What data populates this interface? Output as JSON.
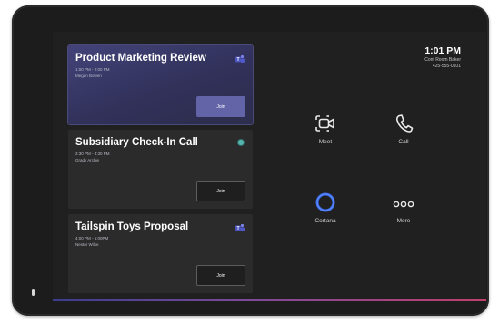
{
  "meetings": [
    {
      "title": "Product Marketing Review",
      "time": "1:00 PM - 2:00 PM",
      "organizer": "Megan Bowen",
      "join_label": "Join",
      "icon": "teams-icon",
      "active": true
    },
    {
      "title": "Subsidiary Check-In Call",
      "time": "2:30 PM - 3:30 PM",
      "organizer": "Grady Archie",
      "join_label": "Join",
      "icon": "status-dot-icon",
      "active": false
    },
    {
      "title": "Tailspin Toys Proposal",
      "time": "4:00 PM - 5:00PM",
      "organizer": "Nestor Wilke",
      "join_label": "Join",
      "icon": "teams-icon",
      "active": false
    }
  ],
  "header": {
    "time": "1:01 PM",
    "room": "Conf Room Baker",
    "phone": "425-555-0101"
  },
  "actions": [
    {
      "label": "Meet",
      "icon": "video-camera-icon"
    },
    {
      "label": "Call",
      "icon": "phone-icon"
    },
    {
      "label": "Cortana",
      "icon": "cortana-icon"
    },
    {
      "label": "More",
      "icon": "more-icon"
    }
  ],
  "colors": {
    "device": "#1c1c1d",
    "screen": "#202020",
    "card": "#2b2b2b",
    "active_card": "#3a3a6a",
    "join_primary": "#6264a7",
    "teams_purple": "#7b83eb",
    "cortana_blue": "#3a6df0",
    "status_teal": "#56b6ad"
  }
}
